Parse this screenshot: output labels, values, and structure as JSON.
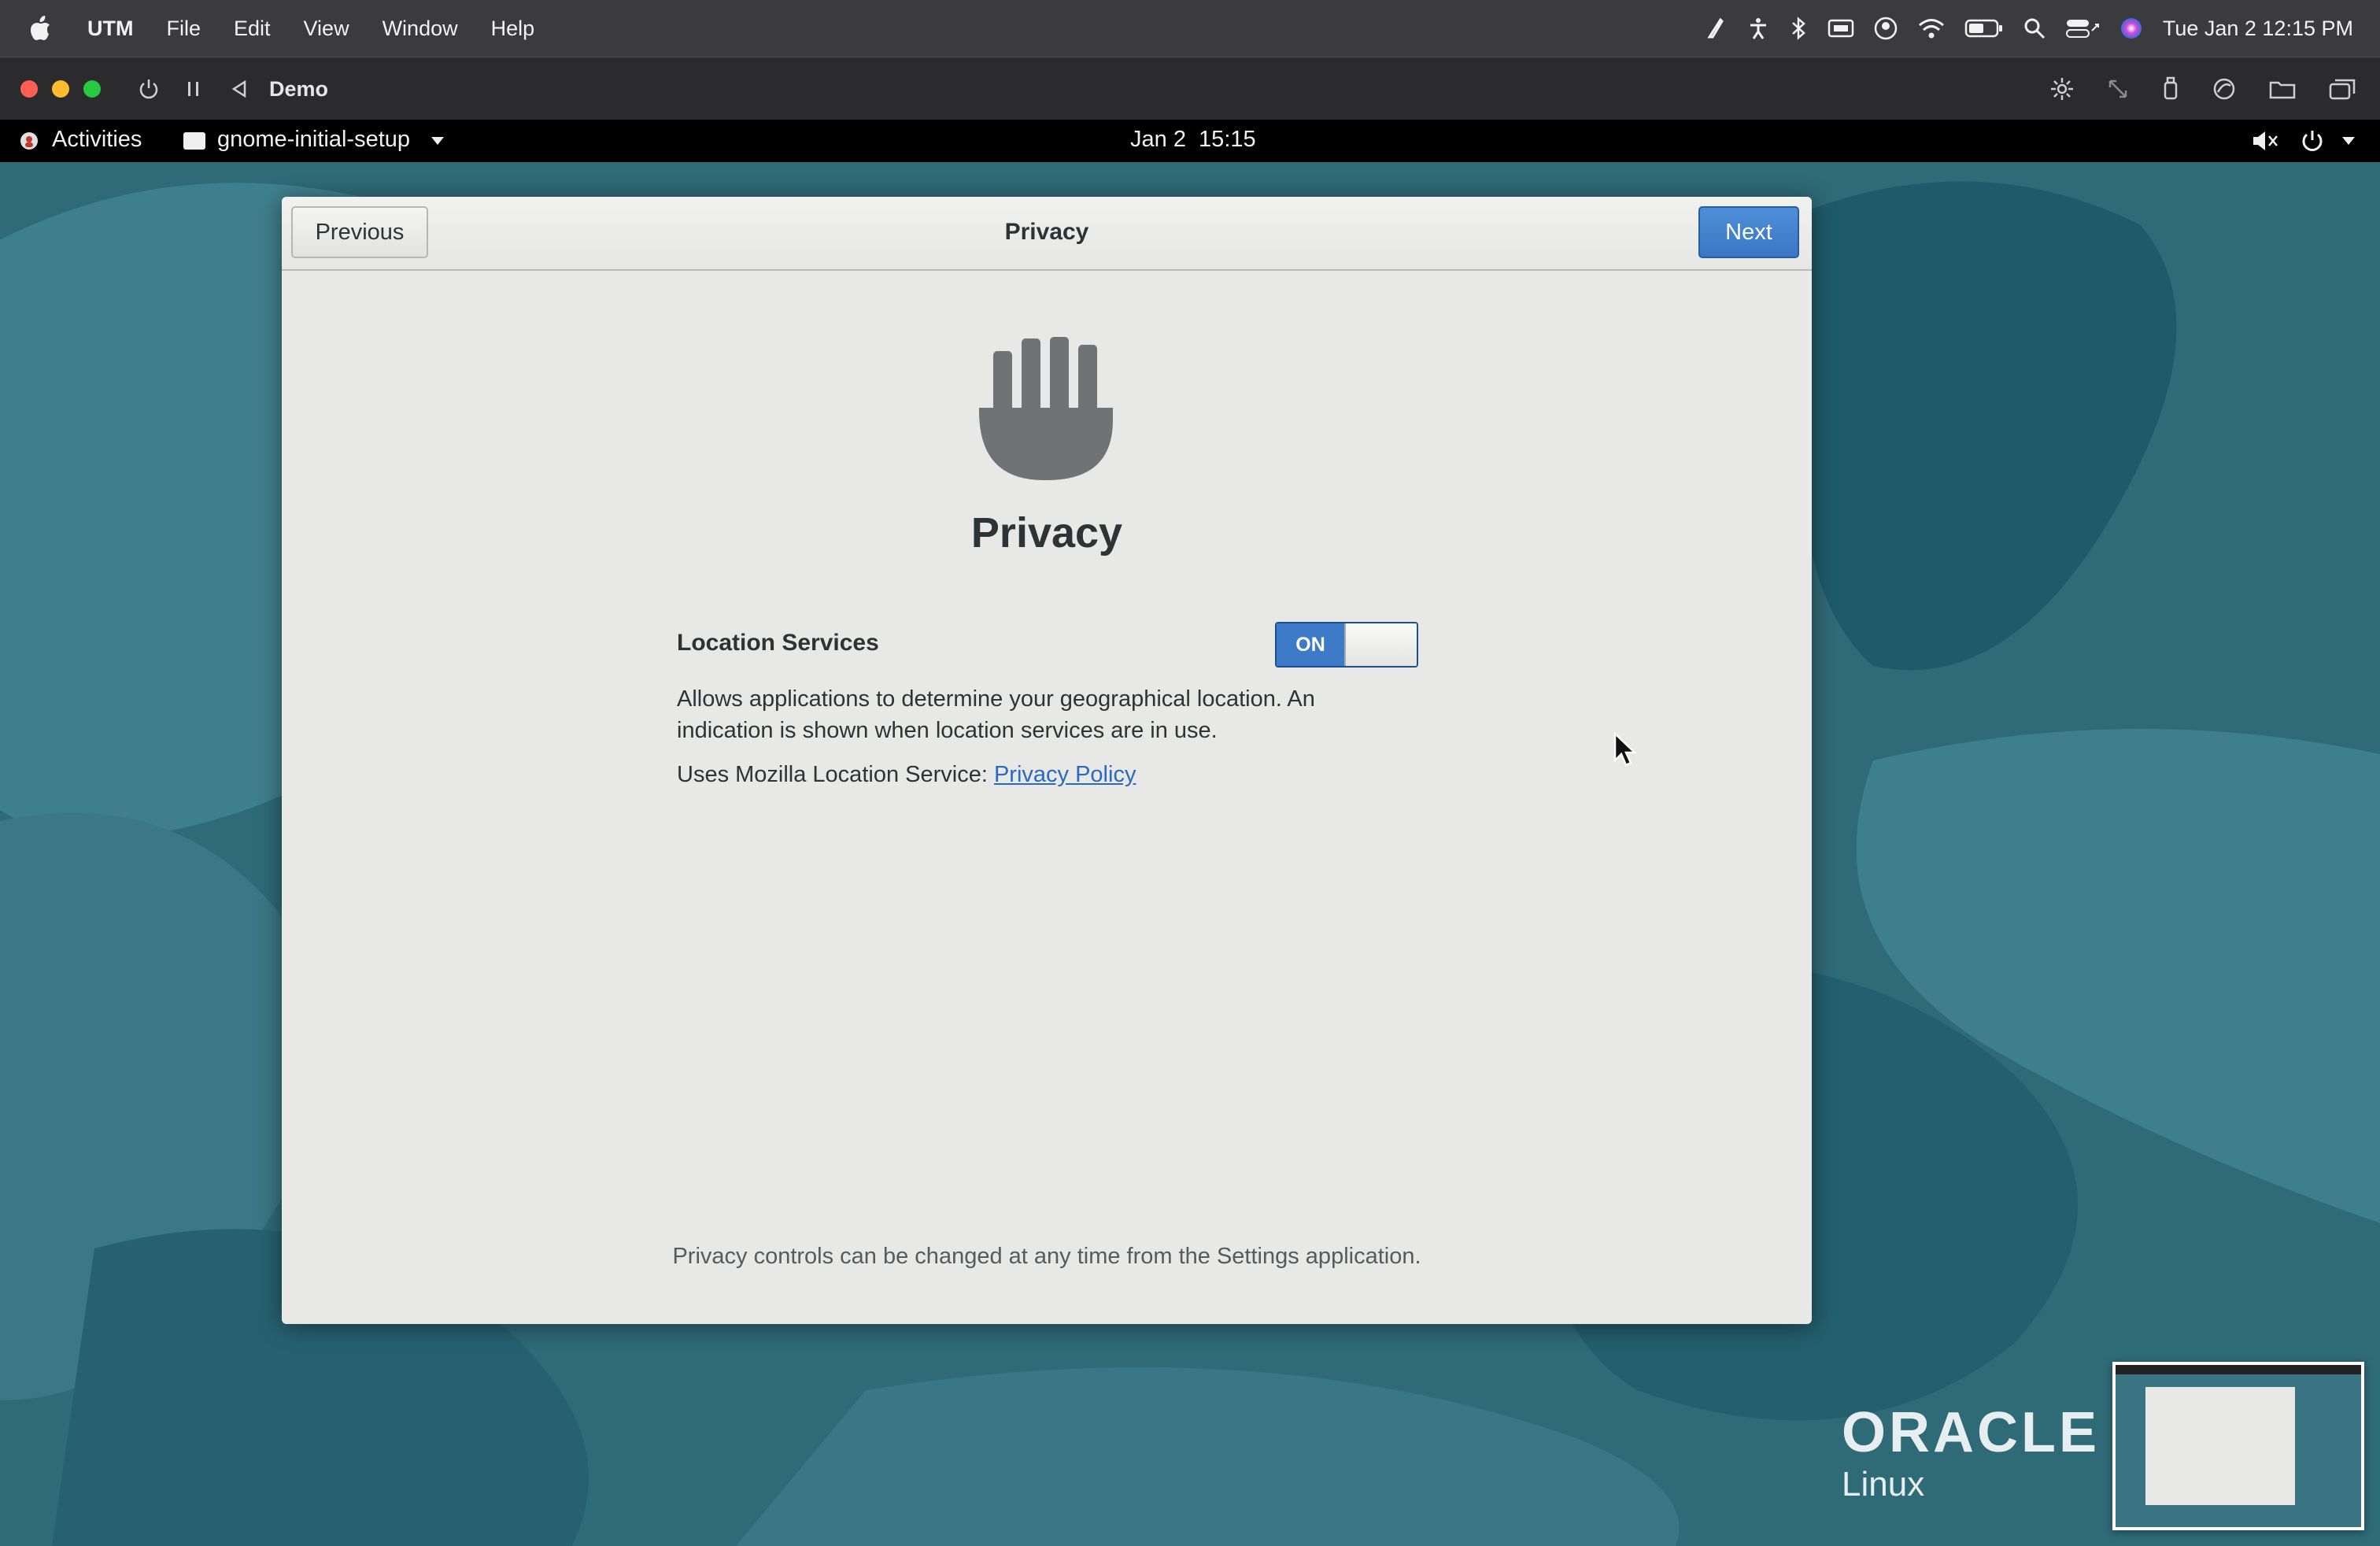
{
  "mac_menubar": {
    "app_name": "UTM",
    "menus": [
      "File",
      "Edit",
      "View",
      "Window",
      "Help"
    ],
    "clock": "Tue Jan 2  12:15 PM"
  },
  "utm_window": {
    "title": "Demo"
  },
  "gnome_topbar": {
    "activities": "Activities",
    "app_menu": "gnome-initial-setup",
    "clock": "Jan 2  15:15"
  },
  "dialog": {
    "header_title": "Privacy",
    "previous_label": "Previous",
    "next_label": "Next",
    "page_heading": "Privacy",
    "location_label": "Location Services",
    "toggle_state": "ON",
    "description_line1": "Allows applications to determine your geographical location. An",
    "description_line2": "indication is shown when location services are in use.",
    "mozilla_text": "Uses Mozilla Location Service: ",
    "privacy_policy_link": "Privacy Policy",
    "footer_note": "Privacy controls can be changed at any time from the Settings application."
  },
  "branding": {
    "logo_word": "ORACLE",
    "logo_sub": "Linux"
  },
  "colors": {
    "desktop": "#2f6a77",
    "accent_blue": "#3d7bc8",
    "mac_close": "#ff5f57",
    "mac_min": "#febc2e",
    "mac_max": "#28c840"
  }
}
